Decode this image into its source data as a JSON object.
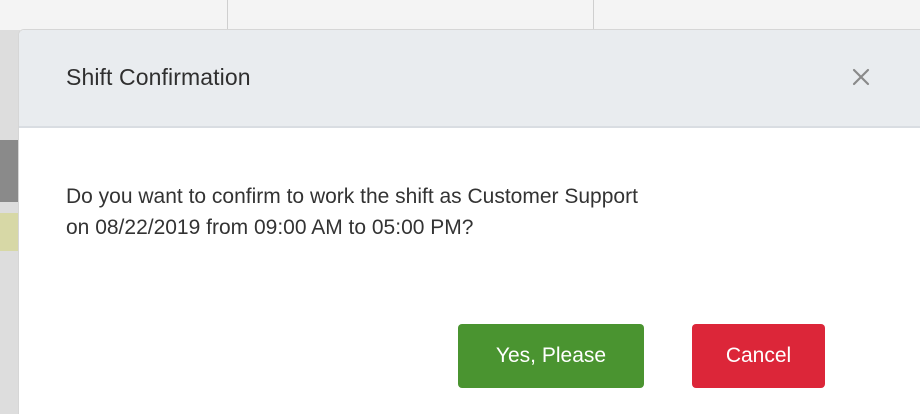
{
  "modal": {
    "title": "Shift Confirmation",
    "close_icon": "close-icon",
    "message_line1": "Do you want to confirm to work the shift as Customer Support",
    "message_line2": "on 08/22/2019 from 09:00 AM to 05:00 PM?",
    "confirm_label": "Yes, Please",
    "cancel_label": "Cancel"
  },
  "colors": {
    "header_bg": "#e9ecef",
    "confirm_button": "#4a9430",
    "cancel_button": "#dc2639"
  }
}
